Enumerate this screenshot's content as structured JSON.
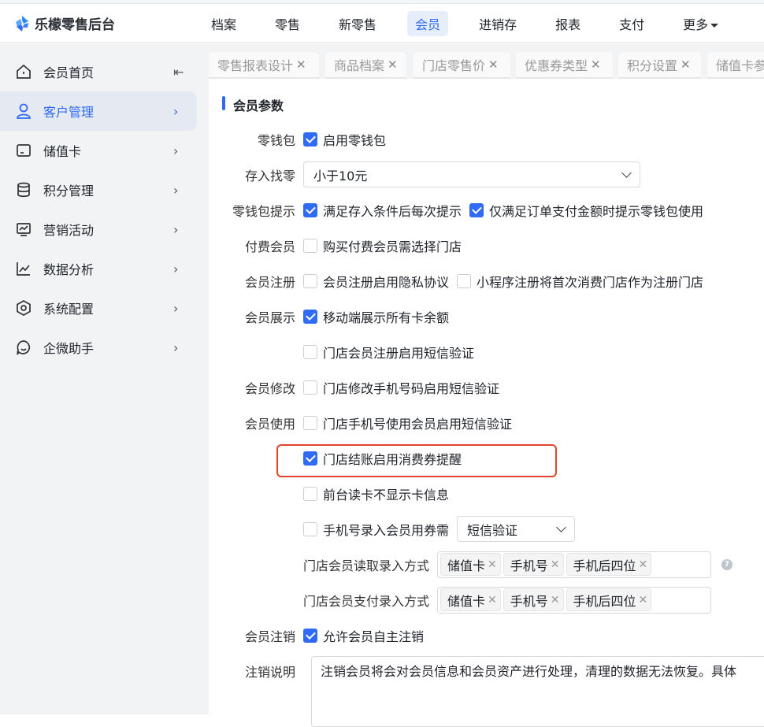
{
  "app": {
    "title": "乐檬零售后台"
  },
  "topnav": [
    {
      "label": "档案"
    },
    {
      "label": "零售"
    },
    {
      "label": "新零售"
    },
    {
      "label": "会员",
      "active": true
    },
    {
      "label": "进销存"
    },
    {
      "label": "报表"
    },
    {
      "label": "支付"
    },
    {
      "label": "更多"
    }
  ],
  "sidebar": {
    "items": [
      {
        "label": "会员首页",
        "icon": "home-icon"
      },
      {
        "label": "客户管理",
        "icon": "user-icon",
        "active": true
      },
      {
        "label": "储值卡",
        "icon": "card-icon"
      },
      {
        "label": "积分管理",
        "icon": "database-icon"
      },
      {
        "label": "营销活动",
        "icon": "monitor-icon"
      },
      {
        "label": "数据分析",
        "icon": "chart-icon"
      },
      {
        "label": "系统配置",
        "icon": "settings-icon"
      },
      {
        "label": "企微助手",
        "icon": "chat-icon"
      }
    ]
  },
  "tabs": [
    {
      "label": "零售报表设计"
    },
    {
      "label": "商品档案"
    },
    {
      "label": "门店零售价"
    },
    {
      "label": "优惠券类型"
    },
    {
      "label": "积分设置"
    },
    {
      "label": "储值卡参"
    }
  ],
  "section": {
    "title": "会员参数"
  },
  "form": {
    "wallet": {
      "label": "零钱包",
      "opt": "启用零钱包"
    },
    "change": {
      "label": "存入找零",
      "value": "小于10元"
    },
    "wallet_tip": {
      "label": "零钱包提示",
      "opt1": "满足存入条件后每次提示",
      "opt2": "仅满足订单支付金额时提示零钱包使用"
    },
    "paid": {
      "label": "付费会员",
      "opt": "购买付费会员需选择门店"
    },
    "register": {
      "label": "会员注册",
      "opt1": "会员注册启用隐私协议",
      "opt2": "小程序注册将首次消费门店作为注册门店"
    },
    "display": {
      "label": "会员展示",
      "opt1": "移动端展示所有卡余额",
      "opt2": "门店会员注册启用短信验证"
    },
    "modify": {
      "label": "会员修改",
      "opt": "门店修改手机号码启用短信验证"
    },
    "use": {
      "label": "会员使用",
      "opt1": "门店手机号使用会员启用短信验证",
      "opt2": "门店结账启用消费券提醒",
      "opt3": "前台读卡不显示卡信息",
      "opt4": "手机号录入会员用券需",
      "opt4_select": "短信验证",
      "read_label": "门店会员读取录入方式",
      "read_tags": [
        "储值卡",
        "手机号",
        "手机后四位"
      ],
      "pay_label": "门店会员支付录入方式",
      "pay_tags": [
        "储值卡",
        "手机号",
        "手机后四位"
      ]
    },
    "cancel": {
      "label": "会员注销",
      "opt": "允许会员自主注销"
    },
    "cancel_desc": {
      "label": "注销说明",
      "value": "注销会员将会对会员信息和会员资产进行处理，清理的数据无法恢复。具体"
    }
  },
  "colors": {
    "accent": "#2f6bf5",
    "highlight": "#e0442c"
  }
}
